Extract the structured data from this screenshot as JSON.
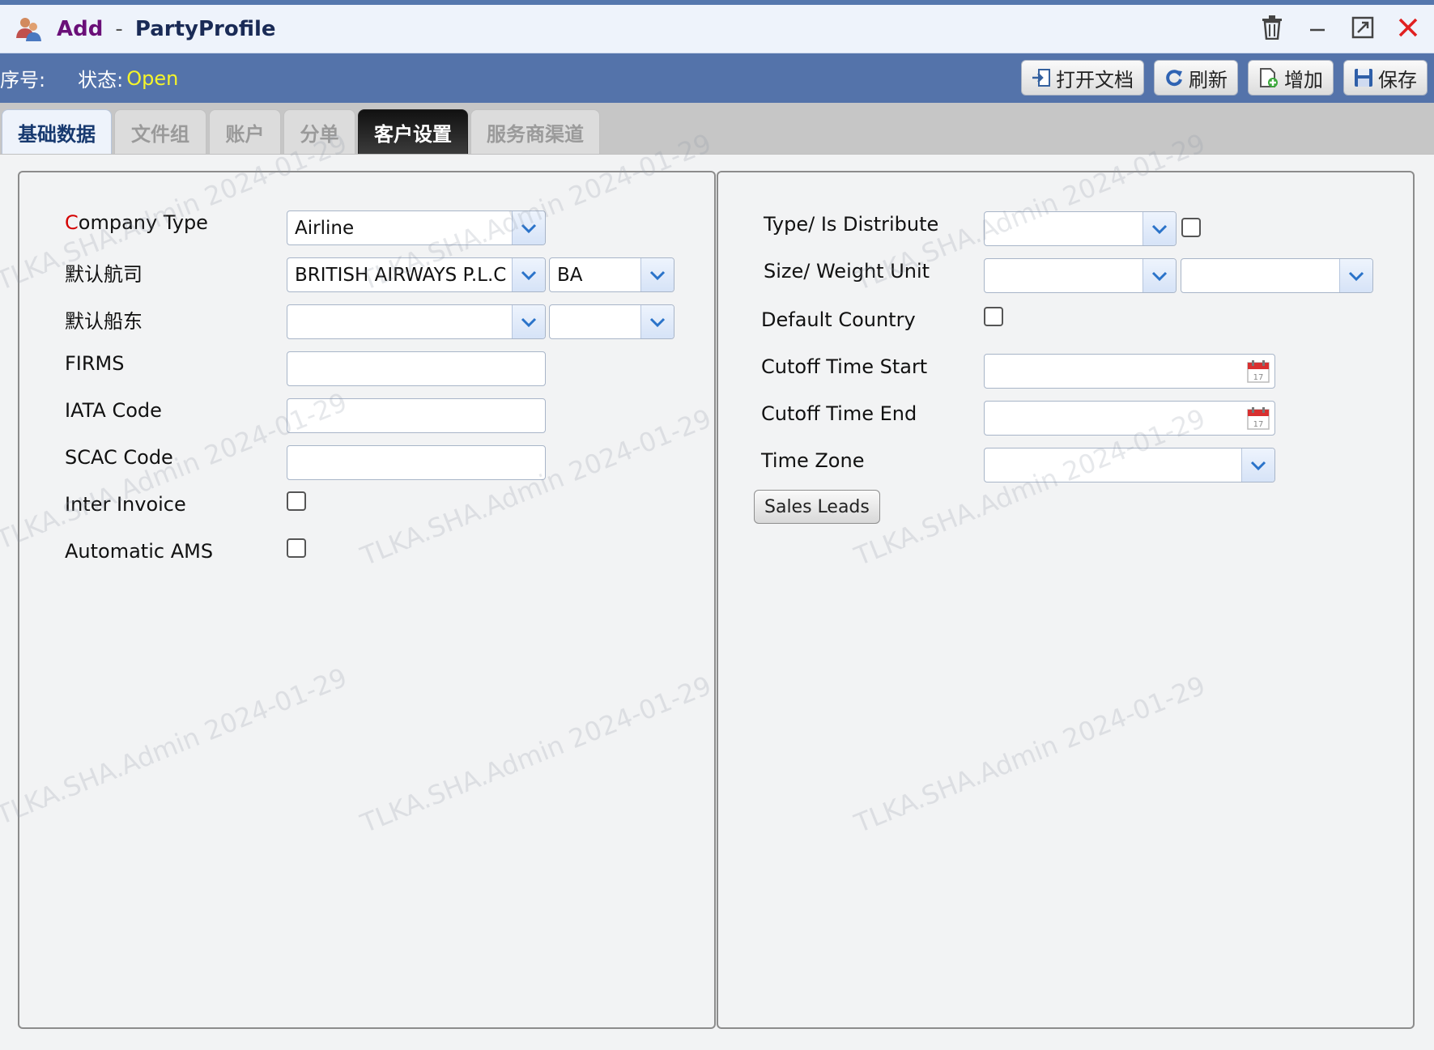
{
  "window": {
    "title_action": "Add",
    "title_separator": "-",
    "title_name": "PartyProfile"
  },
  "status": {
    "serial_label": "序号:",
    "state_label": "状态:",
    "state_value": "Open"
  },
  "actions": {
    "open_doc": "打开文档",
    "refresh": "刷新",
    "add": "增加",
    "save": "保存"
  },
  "tabs": [
    {
      "label": "基础数据"
    },
    {
      "label": "文件组"
    },
    {
      "label": "账户"
    },
    {
      "label": "分单"
    },
    {
      "label": "客户设置"
    },
    {
      "label": "服务商渠道"
    }
  ],
  "left": {
    "company_type_req": "C",
    "company_type_rest": "ompany Type",
    "company_type_value": "Airline",
    "default_airline_label": "默认航司",
    "default_airline_value": "BRITISH AIRWAYS P.L.C",
    "default_airline_code": "BA",
    "default_carrier_label": "默认船东",
    "firms_label": "FIRMS",
    "iata_label": "IATA Code",
    "scac_label": "SCAC Code",
    "inter_invoice_label": "Inter Invoice",
    "automatic_ams_label": "Automatic AMS"
  },
  "right": {
    "type_distribute_label": "Type/ Is Distribute",
    "size_weight_label": "Size/ Weight Unit",
    "default_country_label": "Default Country",
    "cutoff_start_label": "Cutoff Time Start",
    "cutoff_end_label": "Cutoff Time End",
    "time_zone_label": "Time Zone",
    "sales_leads_button": "Sales Leads"
  },
  "watermark": {
    "text": "TLKA.SHA.Admin 2024-01-29"
  },
  "colors": {
    "header_bar": "#5473aa",
    "status_value": "#f5f52a",
    "close": "#e02020",
    "required": "#d40000"
  }
}
